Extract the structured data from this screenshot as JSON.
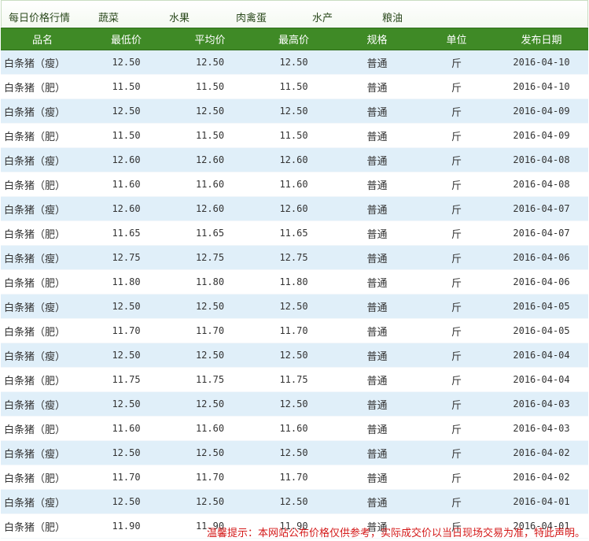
{
  "tabs": [
    "每日价格行情",
    "蔬菜",
    "水果",
    "肉禽蛋",
    "水产",
    "粮油"
  ],
  "table": {
    "headers": [
      "品名",
      "最低价",
      "平均价",
      "最高价",
      "规格",
      "单位",
      "发布日期"
    ],
    "rows": [
      [
        "白条猪（瘦）",
        "12.50",
        "12.50",
        "12.50",
        "普通",
        "斤",
        "2016-04-10"
      ],
      [
        "白条猪（肥）",
        "11.50",
        "11.50",
        "11.50",
        "普通",
        "斤",
        "2016-04-10"
      ],
      [
        "白条猪（瘦）",
        "12.50",
        "12.50",
        "12.50",
        "普通",
        "斤",
        "2016-04-09"
      ],
      [
        "白条猪（肥）",
        "11.50",
        "11.50",
        "11.50",
        "普通",
        "斤",
        "2016-04-09"
      ],
      [
        "白条猪（瘦）",
        "12.60",
        "12.60",
        "12.60",
        "普通",
        "斤",
        "2016-04-08"
      ],
      [
        "白条猪（肥）",
        "11.60",
        "11.60",
        "11.60",
        "普通",
        "斤",
        "2016-04-08"
      ],
      [
        "白条猪（瘦）",
        "12.60",
        "12.60",
        "12.60",
        "普通",
        "斤",
        "2016-04-07"
      ],
      [
        "白条猪（肥）",
        "11.65",
        "11.65",
        "11.65",
        "普通",
        "斤",
        "2016-04-07"
      ],
      [
        "白条猪（瘦）",
        "12.75",
        "12.75",
        "12.75",
        "普通",
        "斤",
        "2016-04-06"
      ],
      [
        "白条猪（肥）",
        "11.80",
        "11.80",
        "11.80",
        "普通",
        "斤",
        "2016-04-06"
      ],
      [
        "白条猪（瘦）",
        "12.50",
        "12.50",
        "12.50",
        "普通",
        "斤",
        "2016-04-05"
      ],
      [
        "白条猪（肥）",
        "11.70",
        "11.70",
        "11.70",
        "普通",
        "斤",
        "2016-04-05"
      ],
      [
        "白条猪（瘦）",
        "12.50",
        "12.50",
        "12.50",
        "普通",
        "斤",
        "2016-04-04"
      ],
      [
        "白条猪（肥）",
        "11.75",
        "11.75",
        "11.75",
        "普通",
        "斤",
        "2016-04-04"
      ],
      [
        "白条猪（瘦）",
        "12.50",
        "12.50",
        "12.50",
        "普通",
        "斤",
        "2016-04-03"
      ],
      [
        "白条猪（肥）",
        "11.60",
        "11.60",
        "11.60",
        "普通",
        "斤",
        "2016-04-03"
      ],
      [
        "白条猪（瘦）",
        "12.50",
        "12.50",
        "12.50",
        "普通",
        "斤",
        "2016-04-02"
      ],
      [
        "白条猪（肥）",
        "11.70",
        "11.70",
        "11.70",
        "普通",
        "斤",
        "2016-04-02"
      ],
      [
        "白条猪（瘦）",
        "12.50",
        "12.50",
        "12.50",
        "普通",
        "斤",
        "2016-04-01"
      ],
      [
        "白条猪（肥）",
        "11.90",
        "11.90",
        "11.90",
        "普通",
        "斤",
        "2016-04-01"
      ]
    ]
  },
  "notice": "温馨提示：本网站公布价格仅供参考，实际成交价以当日现场交易为准，特此声明。",
  "colors": {
    "header_bg": "#3f8a26",
    "stripe": "#e0eff9",
    "notice": "#d41919"
  }
}
